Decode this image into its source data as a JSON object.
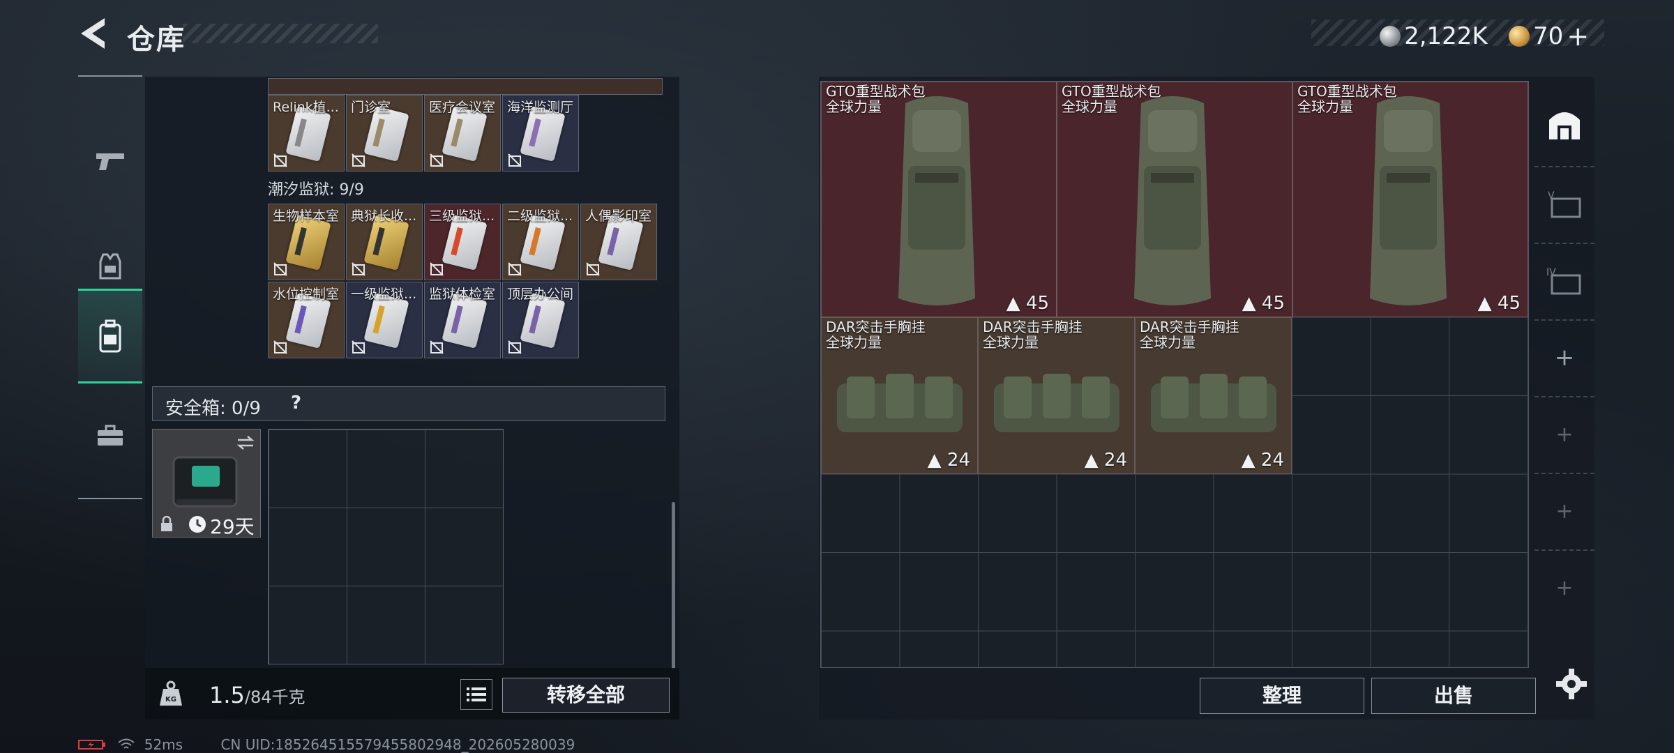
{
  "header": {
    "title": "仓库",
    "currency1": "2,122K",
    "currency2": "70"
  },
  "keycards": {
    "row_a": [
      {
        "label": "Relink植..."
      },
      {
        "label": "门诊室"
      },
      {
        "label": "医疗会议室"
      },
      {
        "label": "海洋监测厅"
      }
    ],
    "section_label": "潮汐监狱: 9/9",
    "row_b": [
      {
        "label": "生物样本室"
      },
      {
        "label": "典狱长收..."
      },
      {
        "label": "三级监狱..."
      },
      {
        "label": "二级监狱..."
      },
      {
        "label": "人偶影印室"
      }
    ],
    "row_c": [
      {
        "label": "水位控制室"
      },
      {
        "label": "一级监狱..."
      },
      {
        "label": "监狱体检室"
      },
      {
        "label": "顶层办公间"
      }
    ]
  },
  "safe": {
    "label": "安全箱: 0/9",
    "help": "?",
    "duration": "29天"
  },
  "footer": {
    "weight_current": "1.5",
    "weight_max": "/84千克",
    "transfer_all": "转移全部"
  },
  "storage": {
    "items": [
      {
        "name": "GTO重型战术包",
        "sub": "全球力量",
        "count": "45"
      },
      {
        "name": "GTO重型战术包",
        "sub": "全球力量",
        "count": "45"
      },
      {
        "name": "GTO重型战术包",
        "sub": "全球力量",
        "count": "45"
      },
      {
        "name": "DAR突击手胸挂",
        "sub": "全球力量",
        "count": "24"
      },
      {
        "name": "DAR突击手胸挂",
        "sub": "全球力量",
        "count": "24"
      },
      {
        "name": "DAR突击手胸挂",
        "sub": "全球力量",
        "count": "24"
      }
    ],
    "sort_button": "整理",
    "sell_button": "出售"
  },
  "status": {
    "ping": "52ms",
    "uid": "CN UID:185264515579455802948_202605280039"
  }
}
